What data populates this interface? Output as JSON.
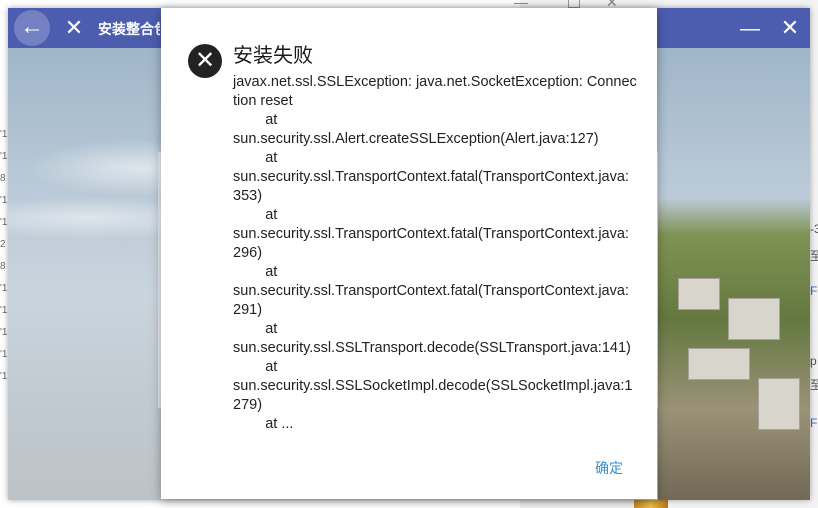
{
  "background": {
    "left_fragments": [
      "'1",
      "'1",
      "8",
      "'1",
      "'1",
      "2",
      "8",
      "'1",
      "'1",
      "'1",
      "'1",
      "'1"
    ],
    "right_fragments": [
      "-3",
      "至",
      "F",
      "p",
      "至",
      "F"
    ]
  },
  "launcher": {
    "title": "安装整合包",
    "back_icon": "←",
    "close_icon": "✕",
    "minimize_icon": "—",
    "window_close_icon": "✕"
  },
  "dialog": {
    "title": "安装失败",
    "icon": "error-x",
    "message": "javax.net.ssl.SSLException: java.net.SocketException: Connection reset\n        at\nsun.security.ssl.Alert.createSSLException(Alert.java:127)\n        at\nsun.security.ssl.TransportContext.fatal(TransportContext.java:353)\n        at\nsun.security.ssl.TransportContext.fatal(TransportContext.java:296)\n        at\nsun.security.ssl.TransportContext.fatal(TransportContext.java:291)\n        at\nsun.security.ssl.SSLTransport.decode(SSLTransport.java:141)\n        at\nsun.security.ssl.SSLSocketImpl.decode(SSLSocketImpl.java:1279)\n        at ...",
    "confirm_label": "确定"
  }
}
